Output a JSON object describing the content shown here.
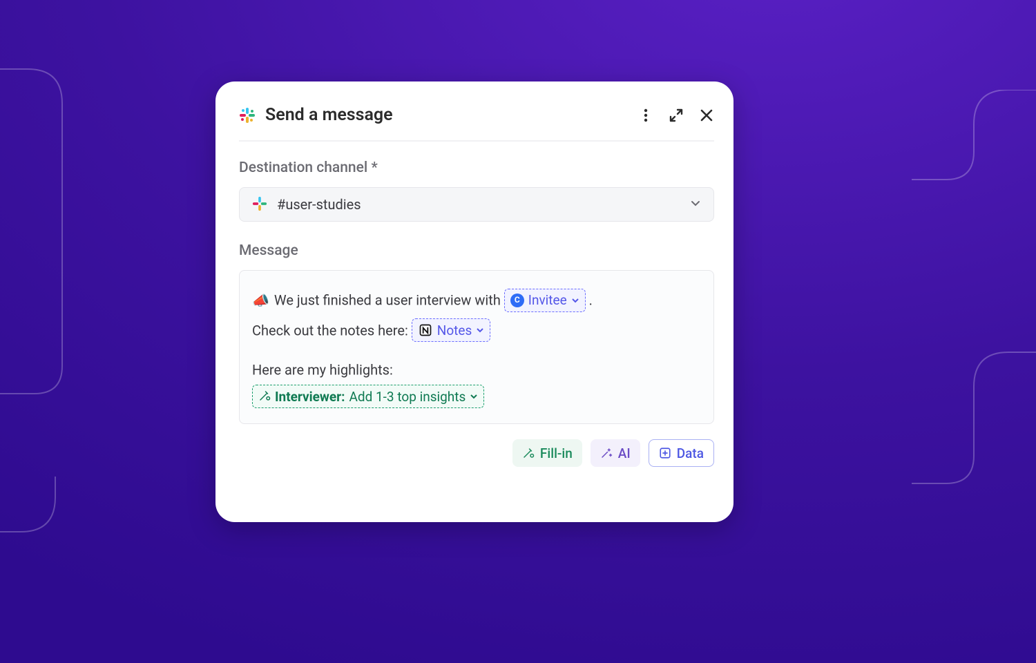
{
  "modal": {
    "title": "Send a message",
    "destination_label": "Destination channel *",
    "channel_value": "#user-studies",
    "message_label": "Message",
    "message": {
      "line1_prefix": " We just finished a user interview with ",
      "invitee_pill": "Invitee",
      "line1_suffix": ".",
      "line2_prefix": "Check out the notes here: ",
      "notes_pill": "Notes",
      "line3": "Here are my highlights:",
      "interviewer_label": "Interviewer:",
      "interviewer_prompt": " Add 1-3 top insights"
    },
    "buttons": {
      "fillin": "Fill-in",
      "ai": "AI",
      "data": "Data"
    }
  }
}
